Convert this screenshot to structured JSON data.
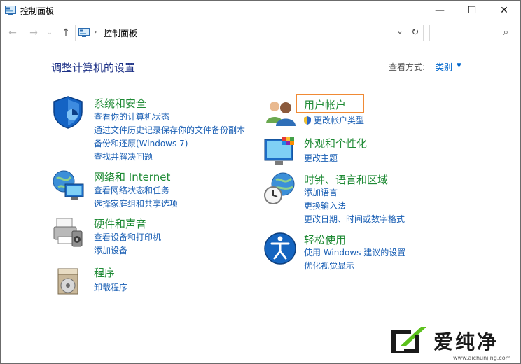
{
  "window": {
    "title": "控制面板",
    "minimize_glyph": "—",
    "maximize_glyph": "☐",
    "close_glyph": "✕"
  },
  "nav": {
    "back_glyph": "←",
    "forward_glyph": "→",
    "recent_glyph": "⌄",
    "up_glyph": "↑",
    "breadcrumb_sep": "›",
    "address": "控制面板",
    "address_dropdown_glyph": "⌄",
    "refresh_glyph": "↻",
    "search_placeholder": "",
    "search_glyph": "⌕"
  },
  "main": {
    "heading": "调整计算机的设置",
    "view_by_label": "查看方式:",
    "view_by_value": "类别",
    "view_by_arrow": "▼"
  },
  "left_categories": [
    {
      "icon": "shield-icon",
      "title": "系统和安全",
      "links": [
        "查看你的计算机状态",
        "通过文件历史记录保存你的文件备份副本",
        "备份和还原(Windows 7)",
        "查找并解决问题"
      ]
    },
    {
      "icon": "network-icon",
      "title": "网络和 Internet",
      "links": [
        "查看网络状态和任务",
        "选择家庭组和共享选项"
      ]
    },
    {
      "icon": "printer-icon",
      "title": "硬件和声音",
      "links": [
        "查看设备和打印机",
        "添加设备"
      ]
    },
    {
      "icon": "programs-icon",
      "title": "程序",
      "links": [
        "卸载程序"
      ]
    }
  ],
  "right_categories": [
    {
      "icon": "users-icon",
      "title": "用户帐户",
      "links": [
        "更改帐户类型"
      ]
    },
    {
      "icon": "display-icon",
      "title": "外观和个性化",
      "links": [
        "更改主题"
      ]
    },
    {
      "icon": "clock-globe-icon",
      "title": "时钟、语言和区域",
      "links": [
        "添加语言",
        "更换输入法",
        "更改日期、时间或数字格式"
      ]
    },
    {
      "icon": "ease-of-access-icon",
      "title": "轻松使用",
      "links": [
        "使用 Windows 建议的设置",
        "优化视觉显示"
      ]
    }
  ],
  "watermark": {
    "text": "爱纯净",
    "url": "www.aichunjing.com"
  },
  "colors": {
    "heading": "#1e3287",
    "category_title": "#1e8a34",
    "link": "#1a5fb4",
    "highlight": "#f08a35"
  }
}
